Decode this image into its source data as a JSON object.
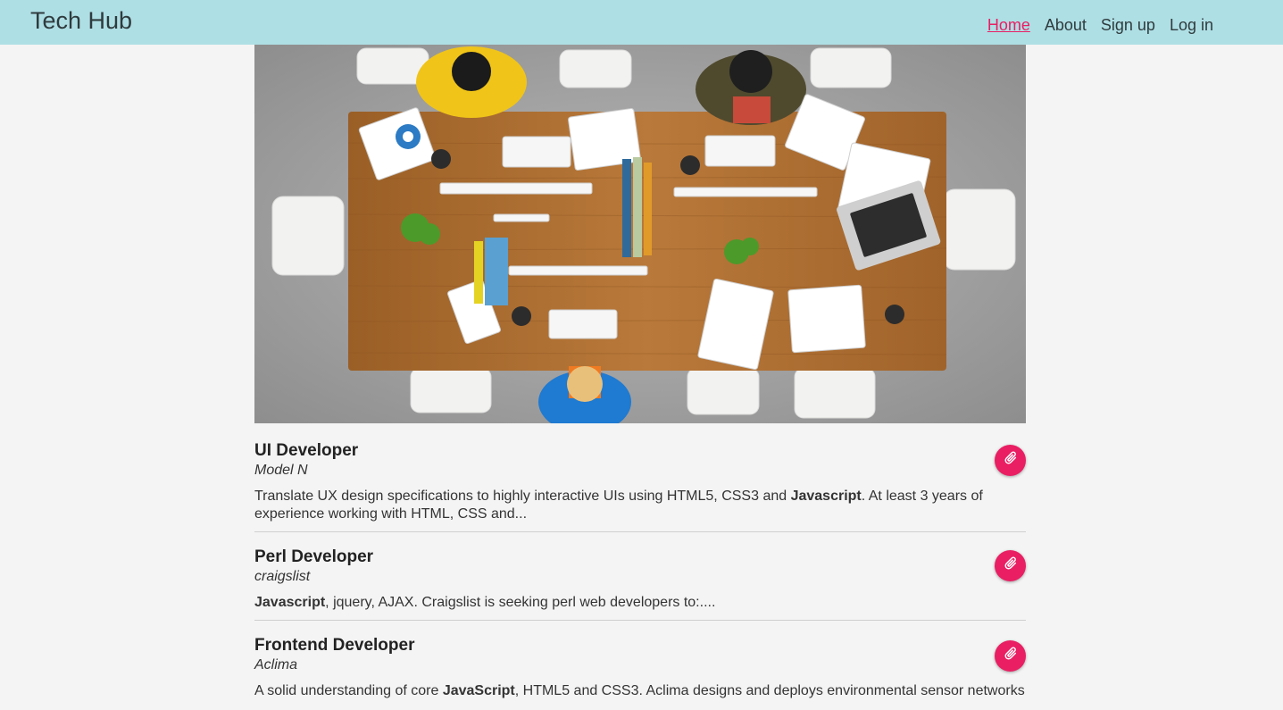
{
  "header": {
    "brand": "Tech Hub",
    "nav": [
      "Home",
      "About",
      "Sign up",
      "Log in"
    ],
    "active": "Home"
  },
  "hero": {
    "icon": "office-table-photo"
  },
  "jobs": [
    {
      "title": "UI Developer",
      "company": "Model N",
      "description": [
        {
          "t": "Translate UX design specifications to highly interactive UIs using HTML5, CSS3 and "
        },
        {
          "t": "Javascript",
          "b": true
        },
        {
          "t": ". At least 3 years of experience working with HTML, CSS and..."
        }
      ]
    },
    {
      "title": "Perl Developer",
      "company": "craigslist",
      "description": [
        {
          "t": "Javascript",
          "b": true
        },
        {
          "t": ", jquery, AJAX. Craigslist is seeking perl web developers to:...."
        }
      ]
    },
    {
      "title": "Frontend Developer",
      "company": "Aclima",
      "description": [
        {
          "t": "A solid understanding of core "
        },
        {
          "t": "JavaScript",
          "b": true
        },
        {
          "t": ", HTML5 and CSS3. Aclima designs and deploys environmental sensor networks"
        }
      ]
    }
  ],
  "colors": {
    "navbar": "#aedfe5",
    "accent": "#e91e63",
    "background": "#f4f4f4"
  },
  "icons": {
    "attach": "paperclip-icon"
  }
}
